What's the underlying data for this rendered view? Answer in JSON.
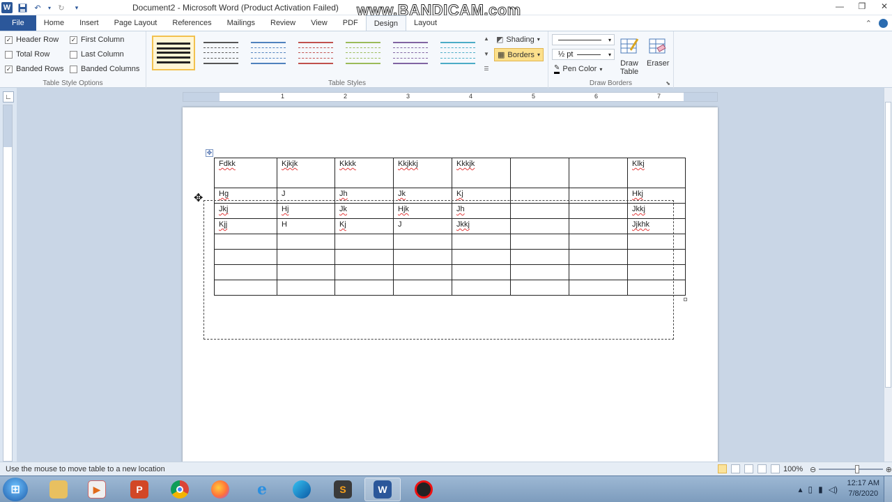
{
  "window": {
    "title": "Document2 - Microsoft Word (Product Activation Failed)",
    "watermark": "www.BANDICAM.com",
    "controls": [
      "—",
      "❐",
      "✕"
    ]
  },
  "ribbon_tabs": [
    {
      "label": "File"
    },
    {
      "label": "Home"
    },
    {
      "label": "Insert"
    },
    {
      "label": "Page Layout"
    },
    {
      "label": "References"
    },
    {
      "label": "Mailings"
    },
    {
      "label": "Review"
    },
    {
      "label": "View"
    },
    {
      "label": "PDF"
    },
    {
      "label": "Design"
    },
    {
      "label": "Layout"
    }
  ],
  "table_style_options": {
    "label": "Table Style Options",
    "header_row": {
      "label": "Header Row",
      "checked": true
    },
    "first_column": {
      "label": "First Column",
      "checked": true
    },
    "total_row": {
      "label": "Total Row",
      "checked": false
    },
    "last_column": {
      "label": "Last Column",
      "checked": false
    },
    "banded_rows": {
      "label": "Banded Rows",
      "checked": true
    },
    "banded_columns": {
      "label": "Banded Columns",
      "checked": false
    }
  },
  "table_styles": {
    "label": "Table Styles",
    "thumb_colors": [
      "#222222",
      "#555555",
      "#4f81bd",
      "#c0504d",
      "#9bbb59",
      "#8064a2",
      "#4bacc6"
    ]
  },
  "draw_borders": {
    "label": "Draw Borders",
    "shading": "Shading",
    "borders": "Borders",
    "pen_weight": "½ pt",
    "pen_color": "Pen Color",
    "draw_table": "Draw Table",
    "eraser": "Eraser"
  },
  "ruler_numbers": [
    "1",
    "2",
    "3",
    "4",
    "5",
    "6",
    "7"
  ],
  "doc_table": {
    "rows": [
      [
        "Fdkk",
        "Kjkjk",
        "Kkkk",
        "Kkjkkj",
        "Kkkjk",
        "",
        "",
        "Klkj"
      ],
      [
        "Hg",
        "J",
        "Jh",
        "Jk",
        "Kj",
        "",
        "",
        "Hkj"
      ],
      [
        "Jkj",
        "Hj",
        "Jk",
        "Hjk",
        "Jh",
        "",
        "",
        "Jkkj"
      ],
      [
        "Kjj",
        "H",
        "Kj",
        "J",
        "Jkkj",
        "",
        "",
        "Jjkhk"
      ],
      [
        "",
        "",
        "",
        "",
        "",
        "",
        "",
        ""
      ],
      [
        "",
        "",
        "",
        "",
        "",
        "",
        "",
        ""
      ],
      [
        "",
        "",
        "",
        "",
        "",
        "",
        "",
        ""
      ],
      [
        "",
        "",
        "",
        "",
        "",
        "",
        "",
        ""
      ]
    ]
  },
  "status_bar": {
    "message": "Use the mouse to move table to a new location",
    "zoom": "100%"
  },
  "taskbar": {
    "apps": [
      "explorer",
      "media-player",
      "powerpoint",
      "chrome",
      "firefox",
      "internet-explorer",
      "edge",
      "sublime-text",
      "word",
      "bandicam"
    ],
    "time": "12:17 AM",
    "date": "7/8/2020"
  }
}
